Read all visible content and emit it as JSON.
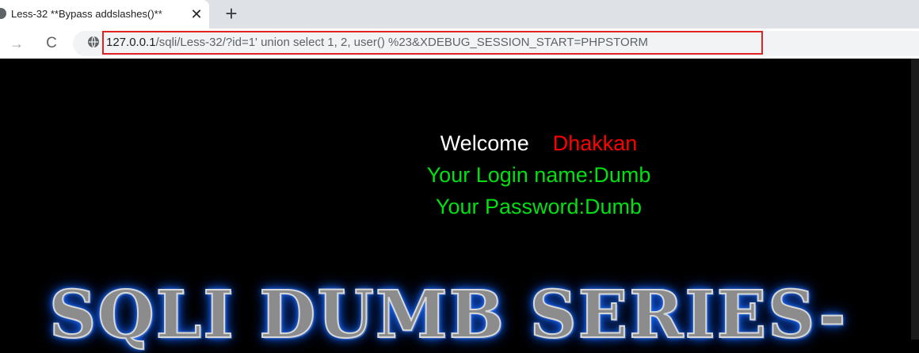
{
  "browser": {
    "tab": {
      "title": "Less-32 **Bypass addslashes()**",
      "close_glyph": "✕",
      "newtab_glyph": "+"
    },
    "nav": {
      "forward_glyph": "→",
      "reload_glyph": "C"
    },
    "url": {
      "host": "127.0.0.1",
      "path": "/sqli/Less-32/?id=1' union select 1, 2, user() %23&XDEBUG_SESSION_START=PHPSTORM"
    }
  },
  "page": {
    "welcome_label": "Welcome",
    "welcome_name": "Dhakkan",
    "login_line": "Your Login name:Dumb",
    "password_line": "Your Password:Dumb",
    "banner": "SQLI DUMB SERIES-"
  },
  "colors": {
    "welcome": "#ffffff",
    "name": "#ff0000",
    "result": "#00e013",
    "url_highlight": "#e02424",
    "banner_glow": "#1a66ff"
  }
}
